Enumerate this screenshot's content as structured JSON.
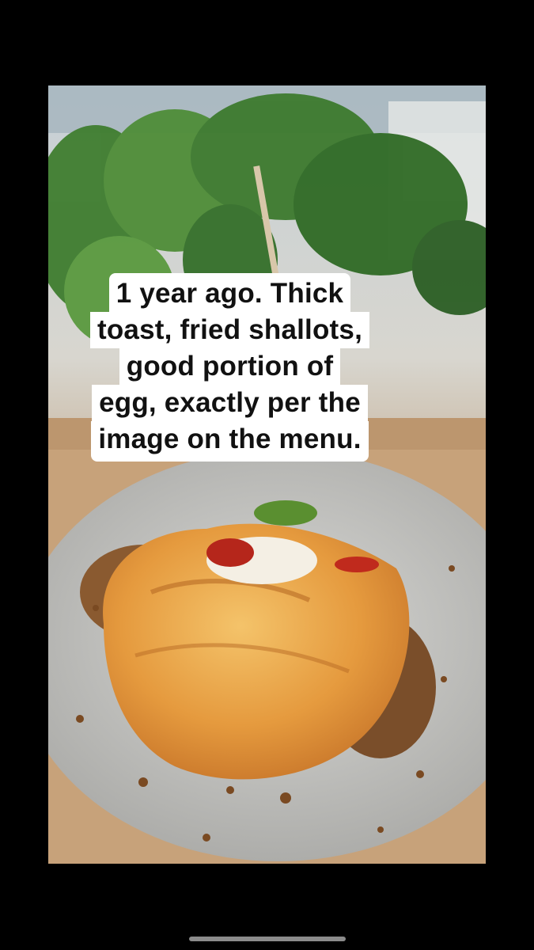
{
  "post": {
    "caption_lines": [
      "1 year ago. Thick",
      "toast, fried shallots,",
      "good portion of",
      "egg, exactly per the",
      "image on the menu."
    ]
  },
  "colors": {
    "background": "#000000",
    "caption_bg": "#ffffff",
    "caption_text": "#111111",
    "egg": "#e8a040",
    "plate": "#c9c9c6",
    "foliage": "#3d7a2e"
  }
}
